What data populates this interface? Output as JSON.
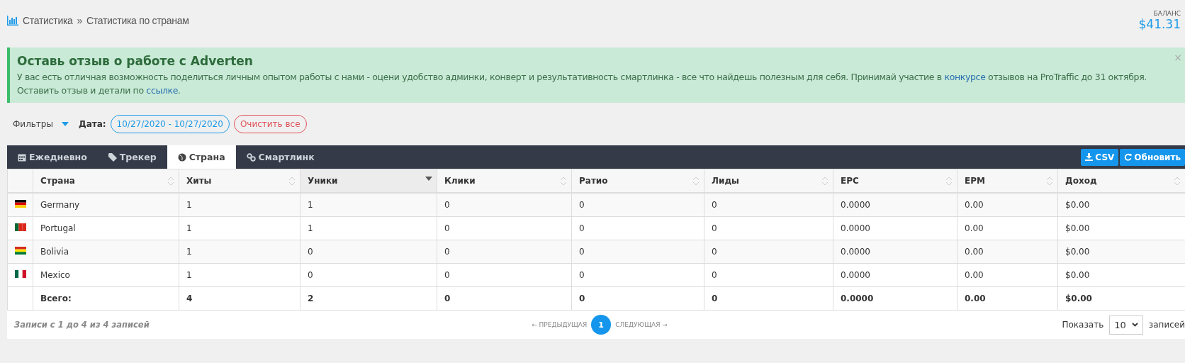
{
  "breadcrumb": {
    "items": [
      "Статистика",
      "Статистика по странам"
    ],
    "separator": "»"
  },
  "balance": {
    "label": "БАЛАНС",
    "value": "$41.31"
  },
  "alert": {
    "title": "Оставь отзыв о работе с Adverten",
    "text": "У вас есть отличная возможность поделиться личным опытом работы с нами - оцени удобство админки, конверт и результативность смартлинка - все что найдешь полезным для себя. Принимай участие в ",
    "link1": "конкурсе",
    "text2": " отзывов на ProTraffic до 31 октября. Оставить отзыв и детали по ",
    "link2": "ссылке",
    "text3": ".",
    "close": "×"
  },
  "filters": {
    "label": "Фильтры",
    "date_label": "Дата:",
    "date_value": "10/27/2020 - 10/27/2020",
    "clear": "Очистить все"
  },
  "tabs": [
    {
      "label": "Ежедневно",
      "selected": false
    },
    {
      "label": "Трекер",
      "selected": false
    },
    {
      "label": "Страна",
      "selected": true
    },
    {
      "label": "Смартлинк",
      "selected": false
    }
  ],
  "actions": [
    "CSV",
    "Обновить"
  ],
  "table": {
    "columns": [
      {
        "label": "Страна",
        "sorted": false
      },
      {
        "label": "Хиты",
        "sorted": false
      },
      {
        "label": "Уники",
        "sorted": true
      },
      {
        "label": "Клики",
        "sorted": false
      },
      {
        "label": "Ратио",
        "sorted": false
      },
      {
        "label": "Лиды",
        "sorted": false
      },
      {
        "label": "EPC",
        "sorted": false
      },
      {
        "label": "EPM",
        "sorted": false
      },
      {
        "label": "Доход",
        "sorted": false
      }
    ],
    "rows": [
      {
        "cells": [
          "Germany",
          "1",
          "1",
          "0",
          "0",
          "0",
          "0.0000",
          "0.00",
          "$0.00"
        ]
      },
      {
        "cells": [
          "Portugal",
          "1",
          "1",
          "0",
          "0",
          "0",
          "0.0000",
          "0.00",
          "$0.00"
        ]
      },
      {
        "cells": [
          "Bolivia",
          "1",
          "0",
          "0",
          "0",
          "0",
          "0.0000",
          "0.00",
          "$0.00"
        ]
      },
      {
        "cells": [
          "Mexico",
          "1",
          "0",
          "0",
          "0",
          "0",
          "0.0000",
          "0.00",
          "$0.00"
        ]
      }
    ],
    "total": [
      "Всего:",
      "4",
      "2",
      "0",
      "0",
      "0",
      "0.0000",
      "0.00",
      "$0.00"
    ]
  },
  "footer": {
    "info": "Записи с 1 до 4 из 4 записей",
    "prev": "← ПРЕДЫДУЩАЯ",
    "pages": [
      {
        "label": "1",
        "selected": true
      }
    ],
    "next": "СЛЕДУЮЩАЯ →",
    "show_label": "Показать",
    "page_size": "10",
    "records_label": "записей"
  }
}
